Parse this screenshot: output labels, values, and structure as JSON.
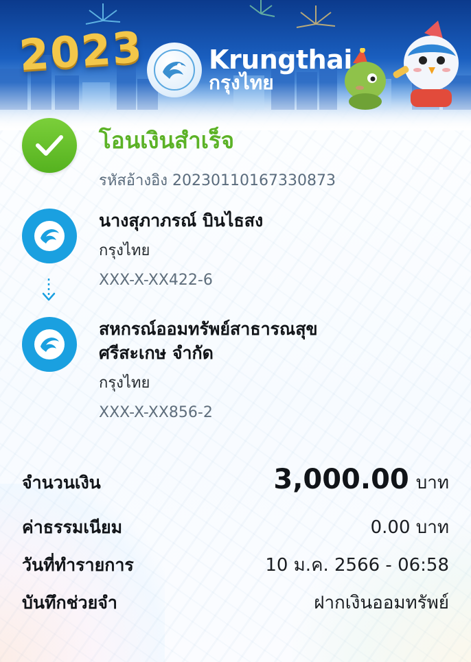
{
  "banner": {
    "year": "2023",
    "brand_en": "Krungthai",
    "brand_th": "กรุงไทย"
  },
  "status": {
    "title": "โอนเงินสำเร็จ",
    "ref_label": "รหัสอ้างอิง",
    "ref_number": "20230110167330873"
  },
  "sender": {
    "name": "นางสุภาภรณ์ บินไธสง",
    "bank": "กรุงไทย",
    "account": "XXX-X-XX422-6"
  },
  "receiver": {
    "name_line1": "สหกรณ์ออมทรัพย์สาธารณสุข",
    "name_line2": "ศรีสะเกษ จำกัด",
    "bank": "กรุงไทย",
    "account": "XXX-X-XX856-2"
  },
  "details": {
    "amount_label": "จำนวนเงิน",
    "amount_value": "3,000.00",
    "amount_unit": "บาท",
    "fee_label": "ค่าธรรมเนียม",
    "fee_value": "0.00 บาท",
    "date_label": "วันที่ทำรายการ",
    "date_value": "10 ม.ค. 2566 - 06:58",
    "memo_label": "บันทึกช่วยจำ",
    "memo_value": "ฝากเงินออมทรัพย์"
  },
  "colors": {
    "success_green": "#5bb226",
    "bank_blue": "#1aa0e0",
    "banner_blue": "#0b3a8c"
  }
}
